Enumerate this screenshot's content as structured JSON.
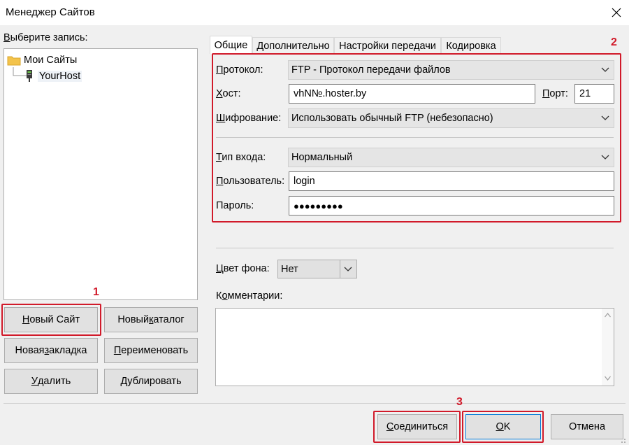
{
  "window": {
    "title": "Менеджер Сайтов"
  },
  "left": {
    "select_label_u": "В",
    "select_label_rest": "ыберите запись:",
    "tree": [
      {
        "label": "Мои Сайты",
        "icon": "folder-icon"
      },
      {
        "label": "YourHost",
        "icon": "server-icon"
      }
    ],
    "buttons": {
      "new_site_u": "Н",
      "new_site_rest": "овый Сайт",
      "new_folder_pre": "Новый ",
      "new_folder_u": "к",
      "new_folder_rest": "аталог",
      "new_bookmark_pre": "Новая ",
      "new_bookmark_u": "з",
      "new_bookmark_rest": "акладка",
      "rename_u": "П",
      "rename_rest": "ереименовать",
      "delete_u": "У",
      "delete_rest": "далить",
      "duplicate_u": "Д",
      "duplicate_rest": "ублировать"
    }
  },
  "tabs": [
    "Общие",
    "Дополнительно",
    "Настройки передачи",
    "Кодировка"
  ],
  "general": {
    "protocol_label_u": "П",
    "protocol_label_rest": "ротокол:",
    "protocol_value": "FTP - Протокол передачи файлов",
    "host_label_u": "Х",
    "host_label_rest": "ост:",
    "host_value": "vhN№.hoster.by",
    "port_label_u": "П",
    "port_label_rest": "орт:",
    "port_value": "21",
    "encryption_label_u": "Ш",
    "encryption_label_rest": "ифрование:",
    "encryption_value": "Использовать обычный FTP (небезопасно)",
    "logon_label_u": "Т",
    "logon_label_rest": "ип входа:",
    "logon_value": "Нормальный",
    "user_label_u": "П",
    "user_label_rest": "ользователь:",
    "user_value": "login",
    "password_label": "Пароль:",
    "password_value": "●●●●●●●●●",
    "bgcolor_label_u": "Ц",
    "bgcolor_label_rest": "вет фона:",
    "bgcolor_value": "Нет",
    "comments_label_pre": "К",
    "comments_label_u": "о",
    "comments_label_rest": "мментарии:"
  },
  "footer": {
    "connect_u": "С",
    "connect_rest": "оединиться",
    "ok_u": "O",
    "ok_rest": "K",
    "cancel": "Отмена"
  },
  "annotations": [
    "1",
    "2",
    "3"
  ],
  "colors": {
    "highlight": "#d11a2a",
    "folder": "#f3c34b",
    "focus": "#0078d7"
  }
}
